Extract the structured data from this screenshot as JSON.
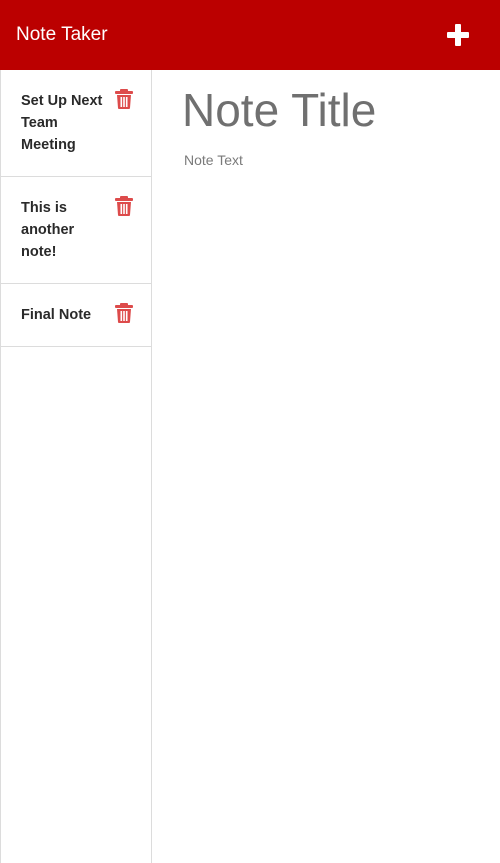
{
  "app": {
    "brand": "Note Taker"
  },
  "colors": {
    "navbar": "#bb0000",
    "delete_icon": "#dd4b4b",
    "plus_icon": "#ffffff"
  },
  "toolbar": {
    "new_note_icon": "plus-icon"
  },
  "sidebar": {
    "notes": [
      {
        "title": "Set Up Next Team Meeting",
        "delete_icon": "trash-icon"
      },
      {
        "title": "This is another note!",
        "delete_icon": "trash-icon"
      },
      {
        "title": "Final Note",
        "delete_icon": "trash-icon"
      }
    ]
  },
  "editor": {
    "title_value": "",
    "title_placeholder": "Note Title",
    "text_value": "",
    "text_placeholder": "Note Text"
  }
}
